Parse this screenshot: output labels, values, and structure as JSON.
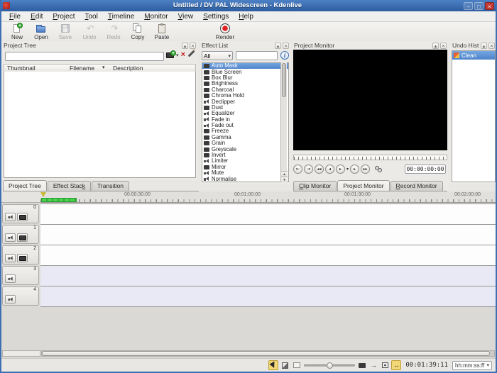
{
  "window": {
    "title": "Untitled / DV PAL Widescreen - Kdenlive",
    "controls": {
      "minimize": "–",
      "maximize": "□",
      "close": "×"
    }
  },
  "icons": {
    "float": "▴",
    "close": "×",
    "dropdown": "▾",
    "sort": "▾",
    "delete": "×",
    "info": "i",
    "scroll_up": "▴",
    "scroll_down": "▾",
    "undo_arrow": "↶",
    "redo_arrow": "↷",
    "snap": "↔"
  },
  "menu_bar": {
    "items": [
      {
        "label": "File",
        "accel": 0
      },
      {
        "label": "Edit",
        "accel": 0
      },
      {
        "label": "Project",
        "accel": 0
      },
      {
        "label": "Tool",
        "accel": 0
      },
      {
        "label": "Timeline",
        "accel": 0
      },
      {
        "label": "Monitor",
        "accel": 0
      },
      {
        "label": "View",
        "accel": 0
      },
      {
        "label": "Settings",
        "accel": 0
      },
      {
        "label": "Help",
        "accel": 0
      }
    ]
  },
  "toolbar": {
    "buttons": [
      {
        "id": "new",
        "label": "New",
        "enabled": true
      },
      {
        "id": "open",
        "label": "Open",
        "enabled": true
      },
      {
        "id": "save",
        "label": "Save",
        "enabled": false
      },
      {
        "id": "undo",
        "label": "Undo",
        "enabled": false
      },
      {
        "id": "redo",
        "label": "Redo",
        "enabled": false
      },
      {
        "id": "copy",
        "label": "Copy",
        "enabled": true
      },
      {
        "id": "paste",
        "label": "Paste",
        "enabled": true
      },
      {
        "id": "render",
        "label": "Render",
        "enabled": true
      }
    ]
  },
  "project_tree": {
    "title": "Project Tree",
    "search_value": "",
    "columns": [
      {
        "label": "Thumbnail"
      },
      {
        "label": "Filename"
      },
      {
        "label": "Description"
      }
    ]
  },
  "effect_list": {
    "title": "Effect List",
    "filter_value": "All",
    "search_value": "",
    "effects": [
      {
        "name": "Auto Mask",
        "type": "video",
        "selected": true
      },
      {
        "name": "Blue Screen",
        "type": "video",
        "selected": false
      },
      {
        "name": "Box Blur",
        "type": "video",
        "selected": false
      },
      {
        "name": "Brightness",
        "type": "video",
        "selected": false
      },
      {
        "name": "Charcoal",
        "type": "video",
        "selected": false
      },
      {
        "name": "Chroma Hold",
        "type": "video",
        "selected": false
      },
      {
        "name": "Declipper",
        "type": "audio",
        "selected": false
      },
      {
        "name": "Dust",
        "type": "video",
        "selected": false
      },
      {
        "name": "Equalizer",
        "type": "audio",
        "selected": false
      },
      {
        "name": "Fade in",
        "type": "audio",
        "selected": false
      },
      {
        "name": "Fade out",
        "type": "audio",
        "selected": false
      },
      {
        "name": "Freeze",
        "type": "video",
        "selected": false
      },
      {
        "name": "Gamma",
        "type": "video",
        "selected": false
      },
      {
        "name": "Grain",
        "type": "video",
        "selected": false
      },
      {
        "name": "Greyscale",
        "type": "video",
        "selected": false
      },
      {
        "name": "Invert",
        "type": "video",
        "selected": false
      },
      {
        "name": "Limiter",
        "type": "audio",
        "selected": false
      },
      {
        "name": "Mirror",
        "type": "video",
        "selected": false
      },
      {
        "name": "Mute",
        "type": "audio",
        "selected": false
      },
      {
        "name": "Normalise",
        "type": "audio",
        "selected": false
      }
    ]
  },
  "project_monitor": {
    "title": "Project Monitor",
    "timecode": "00:00:00:00",
    "transport": [
      {
        "name": "set-zone-start",
        "glyph": "⇤"
      },
      {
        "name": "set-zone-end",
        "glyph": "⇥"
      },
      {
        "name": "rewind",
        "glyph": "◂◂"
      },
      {
        "name": "previous-frame",
        "glyph": "◂"
      },
      {
        "name": "play",
        "glyph": "▸"
      },
      {
        "name": "play-menu",
        "glyph": "▾"
      },
      {
        "name": "next-frame",
        "glyph": "▸"
      },
      {
        "name": "forward",
        "glyph": "▸▸"
      },
      {
        "name": "monitor-config",
        "glyph": ""
      }
    ],
    "tabs": [
      {
        "label": "Clip Monitor",
        "accel": 0,
        "active": false
      },
      {
        "label": "Project Monitor",
        "accel": -1,
        "active": true
      },
      {
        "label": "Record Monitor",
        "accel": 0,
        "active": false
      }
    ]
  },
  "undo_history": {
    "title": "Undo Hist...",
    "items": [
      {
        "label": "Clean",
        "selected": true
      }
    ]
  },
  "timeline": {
    "tabs": [
      {
        "label": "Project Tree",
        "accel": -1,
        "active": true
      },
      {
        "label": "Effect Stack",
        "accel": 11,
        "active": false
      },
      {
        "label": "Transition",
        "accel": -1,
        "active": false
      }
    ],
    "ruler_labels": [
      "00:00:30:00",
      "00:01:00:00",
      "00:01:30:00",
      "00:02:00:00"
    ],
    "tracks": [
      {
        "number": "0",
        "type": "video"
      },
      {
        "number": "1",
        "type": "video"
      },
      {
        "number": "2",
        "type": "video"
      },
      {
        "number": "3",
        "type": "audio"
      },
      {
        "number": "4",
        "type": "audio"
      }
    ]
  },
  "status_bar": {
    "tools": [
      {
        "name": "selection-tool",
        "active": true
      },
      {
        "name": "razor-tool",
        "active": false
      }
    ],
    "view_toggles": [
      {
        "name": "video-thumbnails",
        "active": false
      },
      {
        "name": "audio-thumbnails",
        "active": false
      },
      {
        "name": "marker-comments",
        "active": false
      },
      {
        "name": "snap",
        "active": true
      }
    ],
    "timecode": "00:01:39:11",
    "format": "hh:mm:ss:ff"
  },
  "colors": {
    "titlebar_top": "#4c80c4",
    "titlebar_bottom": "#2e5da0",
    "selection_blue": "#5b92d8",
    "zone_green": "#46cf4a",
    "active_tool_yellow": "#f3d878",
    "window_border": "#3e6fb2",
    "monitor_black": "#000000"
  }
}
